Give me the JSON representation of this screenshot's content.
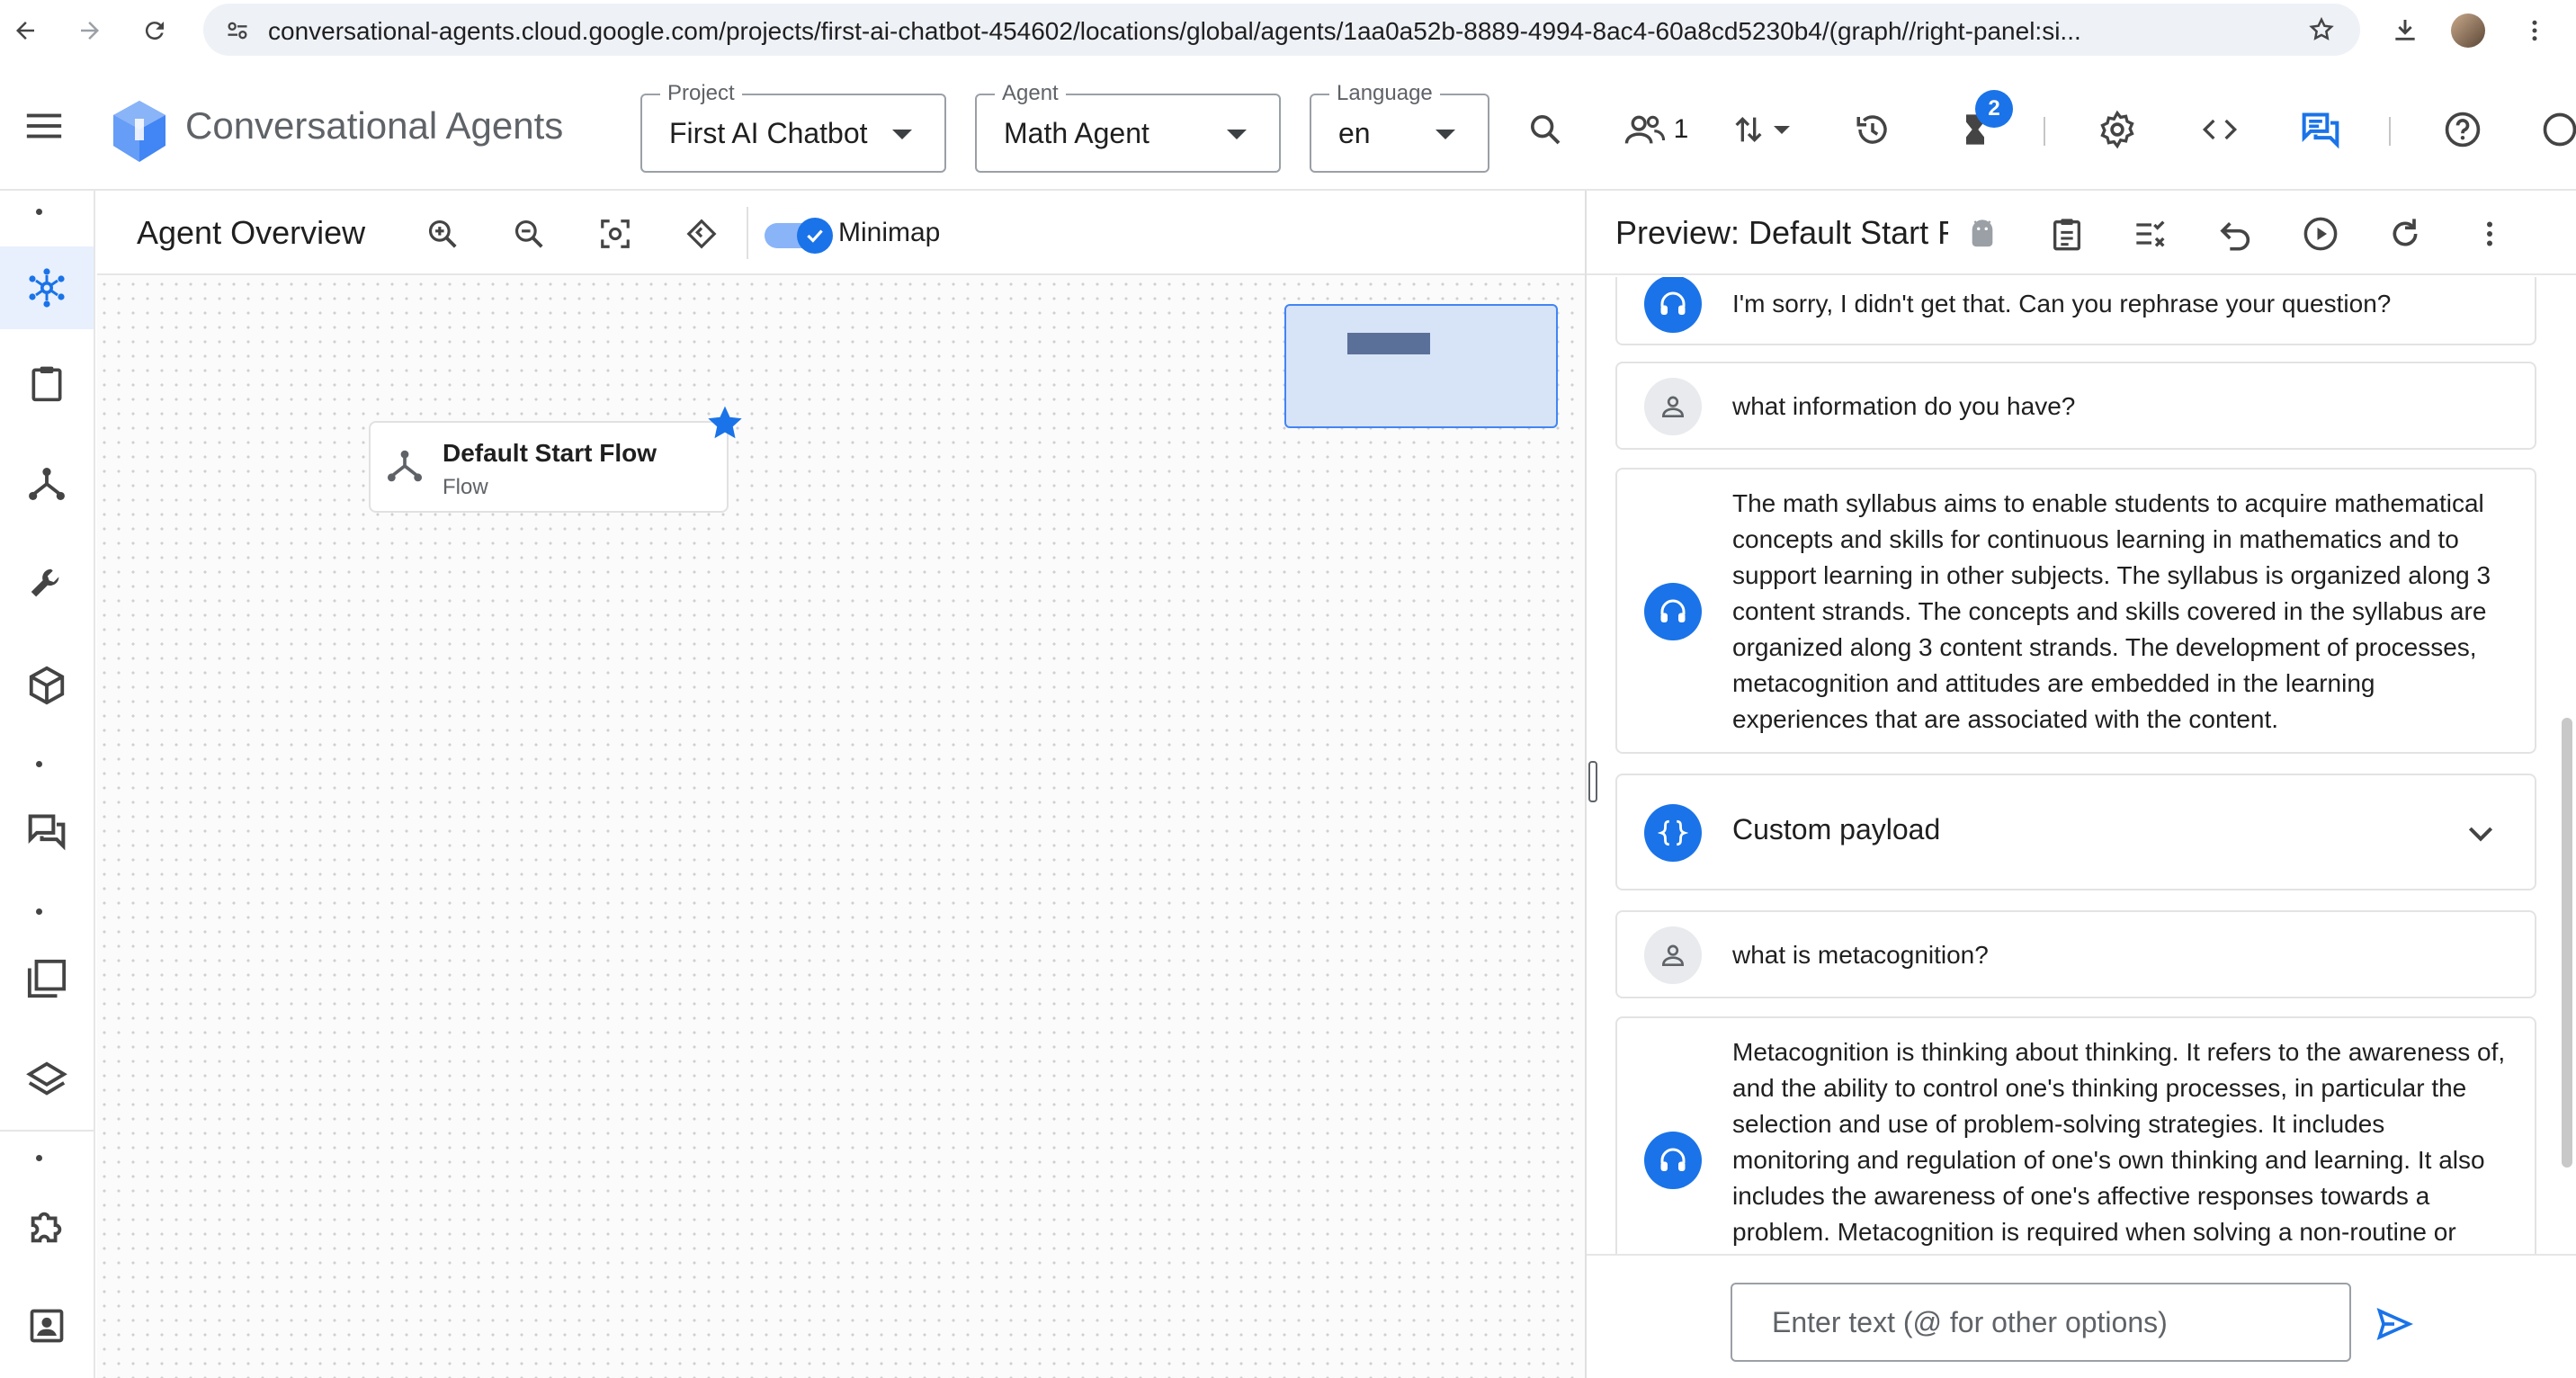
{
  "browser": {
    "url": "conversational-agents.cloud.google.com/projects/first-ai-chatbot-454602/locations/global/agents/1aa0a52b-8889-4994-8ac4-60a8cd5230b4/(graph//right-panel:si..."
  },
  "header": {
    "app_title": "Conversational Agents",
    "project_label": "Project",
    "project_value": "First AI Chatbot",
    "agent_label": "Agent",
    "agent_value": "Math Agent",
    "language_label": "Language",
    "language_value": "en",
    "collaborators_count": "1",
    "notification_badge": "2"
  },
  "canvas": {
    "title": "Agent Overview",
    "minimap_label": "Minimap",
    "minimap_enabled": true,
    "flow_node": {
      "name": "Default Start Flow",
      "type": "Flow"
    }
  },
  "preview": {
    "title": "Preview: Default Start Flow",
    "messages": [
      {
        "role": "agent",
        "text": "I'm sorry, I didn't get that. Can you rephrase your question?"
      },
      {
        "role": "user",
        "text": "what information do you have?"
      },
      {
        "role": "agent",
        "text": "The math syllabus aims to enable students to acquire mathematical concepts and skills for continuous learning in mathematics and to support learning in other subjects. The syllabus is organized along 3 content strands. The concepts and skills covered in the syllabus are organized along 3 content strands. The development of processes, metacognition and attitudes are embedded in the learning experiences that are associated with the content."
      },
      {
        "role": "payload",
        "text": "Custom payload"
      },
      {
        "role": "user",
        "text": "what is metacognition?"
      },
      {
        "role": "agent",
        "text": "Metacognition is thinking about thinking. It refers to the awareness of, and the ability to control one's thinking processes, in particular the selection and use of problem-solving strategies. It includes monitoring and regulation of one's own thinking and learning. It also includes the awareness of one's affective responses towards a problem. Metacognition is required when solving a non-routine or"
      }
    ],
    "input_placeholder": "Enter text (@ for other options)"
  },
  "colors": {
    "accent": "#1a73e8",
    "minimap_fill": "#d7e3f7"
  },
  "icons": {
    "rail": [
      "graph-icon",
      "clipboard-icon",
      "flow-icon",
      "wrench-icon",
      "package-icon",
      "chat-icon",
      "library-icon",
      "layers-icon",
      "puzzle-icon",
      "contact-card-icon"
    ]
  }
}
